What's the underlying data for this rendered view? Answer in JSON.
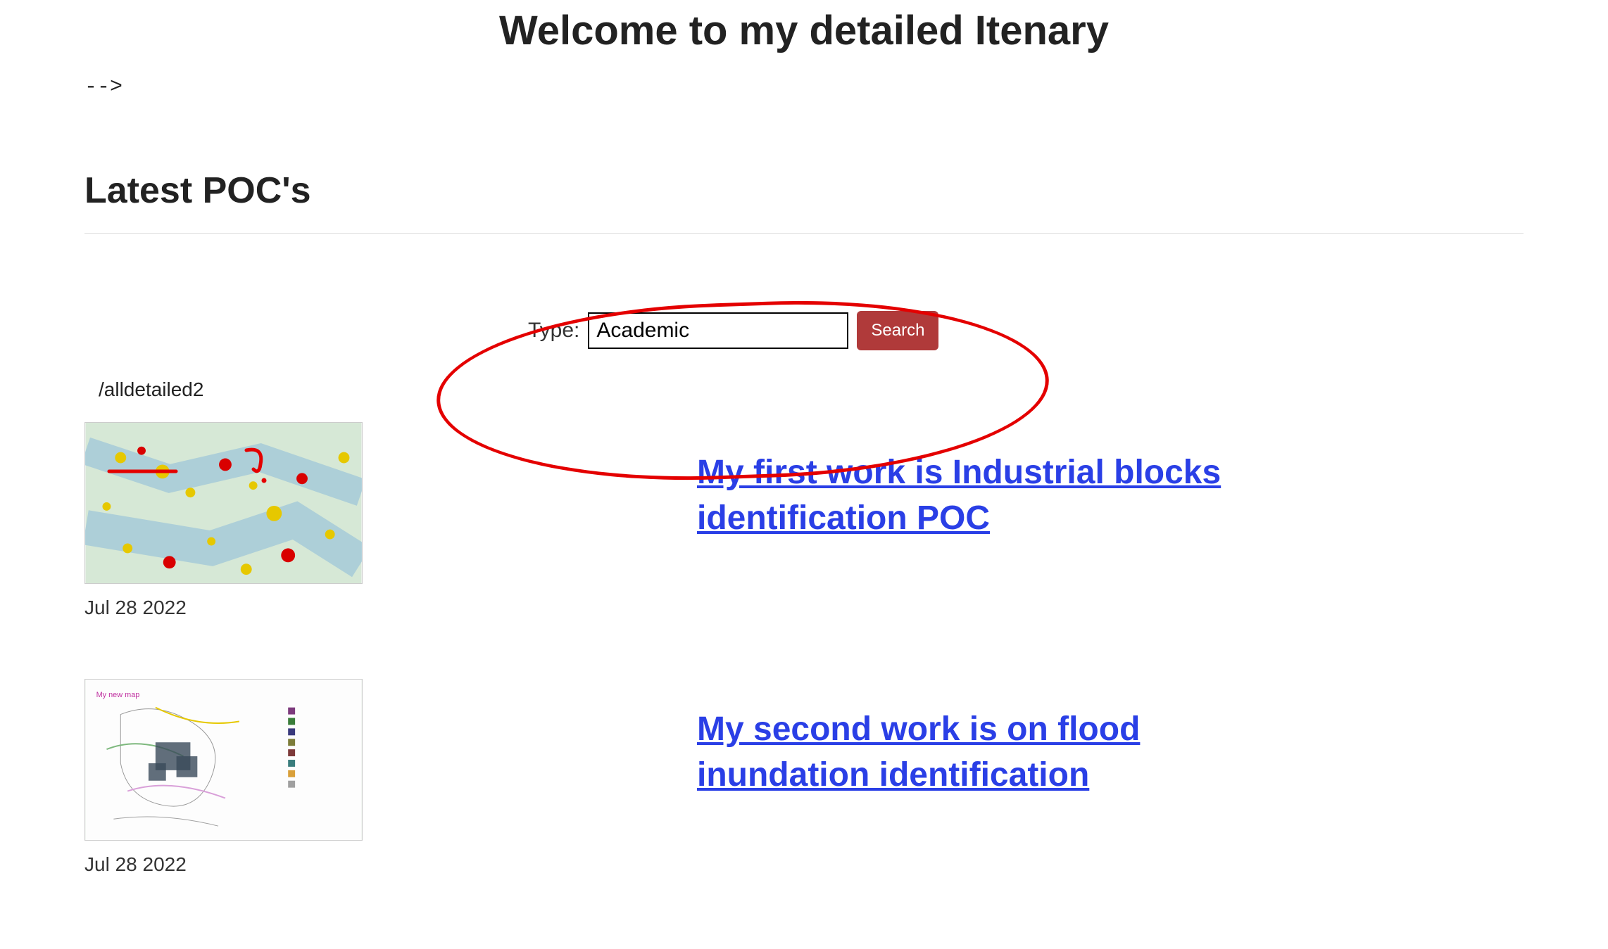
{
  "page": {
    "title": "Welcome to my detailed Itenary",
    "stray_text": "-->"
  },
  "section": {
    "heading": "Latest POC's"
  },
  "search": {
    "label": "Type:",
    "value": "Academic",
    "button_label": "Search"
  },
  "route": {
    "path_text": "/alldetailed2"
  },
  "items": [
    {
      "date": "Jul 28 2022",
      "title": "My first work is Industrial blocks identification POC",
      "thumb_alt": "industrial-blocks-map-thumbnail"
    },
    {
      "date": "Jul 28 2022",
      "title": "My second work is on flood inundation identification",
      "thumb_alt": "flood-inundation-map-thumbnail"
    }
  ]
}
